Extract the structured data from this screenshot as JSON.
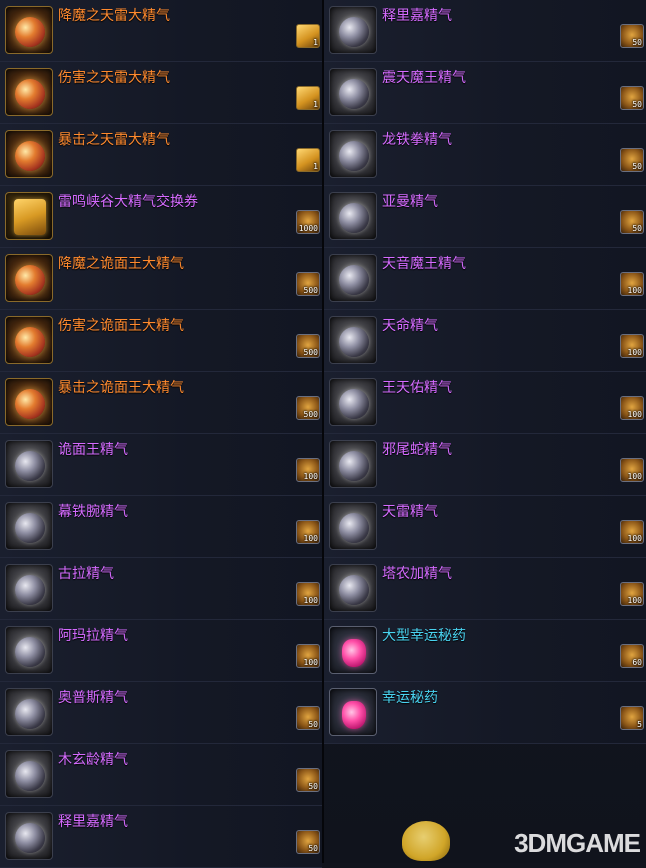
{
  "left_column": [
    {
      "name": "降魔之天雷大精气",
      "color": "orange",
      "icon": "gold-orb-icon",
      "cost": "1",
      "cost_icon": "card"
    },
    {
      "name": "伤害之天雷大精气",
      "color": "orange",
      "icon": "gold-orb-icon",
      "cost": "1",
      "cost_icon": "card"
    },
    {
      "name": "暴击之天雷大精气",
      "color": "orange",
      "icon": "gold-orb-icon",
      "cost": "1",
      "cost_icon": "card"
    },
    {
      "name": "雷鸣峡谷大精气交换券",
      "color": "purple",
      "icon": "ticket-icon",
      "cost": "1000",
      "cost_icon": "coin"
    },
    {
      "name": "降魔之诡面王大精气",
      "color": "orange",
      "icon": "gold-orb-icon",
      "cost": "500",
      "cost_icon": "coin"
    },
    {
      "name": "伤害之诡面王大精气",
      "color": "orange",
      "icon": "gold-orb-icon",
      "cost": "500",
      "cost_icon": "coin"
    },
    {
      "name": "暴击之诡面王大精气",
      "color": "orange",
      "icon": "gold-orb-icon",
      "cost": "500",
      "cost_icon": "coin"
    },
    {
      "name": "诡面王精气",
      "color": "purple",
      "icon": "orb-icon",
      "cost": "100",
      "cost_icon": "coin"
    },
    {
      "name": "幕铁腕精气",
      "color": "purple",
      "icon": "orb-icon",
      "cost": "100",
      "cost_icon": "coin"
    },
    {
      "name": "古拉精气",
      "color": "purple",
      "icon": "orb-icon",
      "cost": "100",
      "cost_icon": "coin"
    },
    {
      "name": "阿玛拉精气",
      "color": "purple",
      "icon": "orb-icon",
      "cost": "100",
      "cost_icon": "coin"
    },
    {
      "name": "奥普斯精气",
      "color": "purple",
      "icon": "orb-icon",
      "cost": "50",
      "cost_icon": "coin"
    },
    {
      "name": "木玄龄精气",
      "color": "purple",
      "icon": "orb-icon",
      "cost": "50",
      "cost_icon": "coin"
    },
    {
      "name": "释里嘉精气",
      "color": "purple",
      "icon": "orb-icon",
      "cost": "50",
      "cost_icon": "coin"
    }
  ],
  "right_column": [
    {
      "name": "释里嘉精气",
      "color": "purple",
      "icon": "orb-icon",
      "cost": "50",
      "cost_icon": "coin"
    },
    {
      "name": "震天魔王精气",
      "color": "purple",
      "icon": "orb-icon",
      "cost": "50",
      "cost_icon": "coin"
    },
    {
      "name": "龙铁拳精气",
      "color": "purple",
      "icon": "orb-icon",
      "cost": "50",
      "cost_icon": "coin"
    },
    {
      "name": "亚曼精气",
      "color": "purple",
      "icon": "orb-icon",
      "cost": "50",
      "cost_icon": "coin"
    },
    {
      "name": "天音魔王精气",
      "color": "purple",
      "icon": "orb-icon",
      "cost": "100",
      "cost_icon": "coin"
    },
    {
      "name": "天命精气",
      "color": "purple",
      "icon": "orb-icon",
      "cost": "100",
      "cost_icon": "coin"
    },
    {
      "name": "王天佑精气",
      "color": "purple",
      "icon": "orb-icon",
      "cost": "100",
      "cost_icon": "coin"
    },
    {
      "name": "邪尾蛇精气",
      "color": "purple",
      "icon": "orb-icon",
      "cost": "100",
      "cost_icon": "coin"
    },
    {
      "name": "天雷精气",
      "color": "purple",
      "icon": "orb-icon",
      "cost": "100",
      "cost_icon": "coin"
    },
    {
      "name": "塔农加精气",
      "color": "purple",
      "icon": "orb-icon",
      "cost": "100",
      "cost_icon": "coin"
    },
    {
      "name": "大型幸运秘药",
      "color": "cyan",
      "icon": "potion-icon",
      "cost": "60",
      "cost_icon": "coin"
    },
    {
      "name": "幸运秘药",
      "color": "cyan",
      "icon": "potion-icon",
      "cost": "5",
      "cost_icon": "coin"
    }
  ],
  "watermark": "3DMGAME",
  "colors": {
    "orange": "#ff8a2e",
    "purple": "#d56bff",
    "cyan": "#49d3f0",
    "background": "#11141d"
  }
}
